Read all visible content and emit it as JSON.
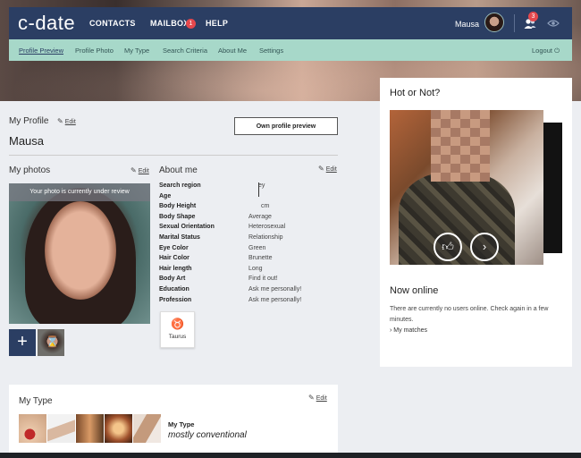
{
  "header": {
    "logo": "c-date",
    "nav": {
      "contacts": "CONTACTS",
      "mailbox": "MAILBOX",
      "mailbox_badge": "1",
      "help": "HELP"
    },
    "username": "Mausa",
    "friends_badge": "3"
  },
  "subnav": {
    "items": [
      "Profile Preview",
      "Profile Photo",
      "My Type",
      "Search Criteria",
      "About Me",
      "Settings"
    ],
    "logout": "Logout"
  },
  "profile": {
    "heading": "My Profile",
    "edit": "Edit",
    "name": "Mausa",
    "own_preview_button": "Own profile preview"
  },
  "photos": {
    "heading": "My photos",
    "edit": "Edit",
    "review_notice": "Your photo is currently under review"
  },
  "about": {
    "heading": "About me",
    "edit": "Edit",
    "rows": [
      {
        "label": "Search region",
        "value": "ey"
      },
      {
        "label": "Age",
        "value": ""
      },
      {
        "label": "Body Height",
        "value": "cm"
      },
      {
        "label": "Body Shape",
        "value": "Average"
      },
      {
        "label": "Sexual Orientation",
        "value": "Heterosexual"
      },
      {
        "label": "Marital Status",
        "value": "Relationship"
      },
      {
        "label": "Eye Color",
        "value": "Green"
      },
      {
        "label": "Hair Color",
        "value": "Brunette"
      },
      {
        "label": "Hair length",
        "value": "Long"
      },
      {
        "label": "Body Art",
        "value": "Find it out!"
      },
      {
        "label": "Education",
        "value": "Ask me personally!"
      },
      {
        "label": "Profession",
        "value": "Ask me personally!"
      }
    ],
    "zodiac": {
      "symbol": "♉",
      "label": "Taurus"
    }
  },
  "mytype": {
    "heading": "My Type",
    "edit": "Edit",
    "label": "My Type",
    "value": "mostly conventional"
  },
  "hot_or_not": {
    "heading": "Hot or Not?"
  },
  "now_online": {
    "heading": "Now online",
    "text": "There are currently no users online. Check again in a few minutes.",
    "my_matches": "My matches"
  },
  "colors": {
    "topbar": "#2b3e63",
    "subbar": "#a7d8c9",
    "badge": "#e5484d"
  }
}
